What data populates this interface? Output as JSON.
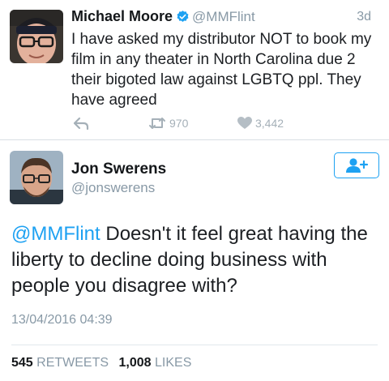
{
  "tweet1": {
    "name": "Michael Moore",
    "handle": "@MMFlint",
    "time": "3d",
    "text": "I have asked my distributor NOT to book my film in any theater in North Carolina due 2 their bigoted law against LGBTQ ppl. They have agreed",
    "retweets": "970",
    "likes": "3,442",
    "icons": {
      "reply": "reply-icon",
      "retweet": "retweet-icon",
      "like": "heart-icon",
      "verified": "verified-badge-icon"
    }
  },
  "tweet2": {
    "name": "Jon Swerens",
    "handle": "@jonswerens",
    "mention": "@MMFlint",
    "text": " Doesn't it feel great having the liberty to decline doing business with people you disagree with?",
    "date": "13/04/2016 04:39",
    "retweet_count": "545",
    "retweet_label": "RETWEETS",
    "like_count": "1,008",
    "like_label": "LIKES",
    "icons": {
      "follow": "add-user-icon"
    }
  },
  "colors": {
    "accent": "#1da1f2",
    "muted": "#8899a6",
    "text": "#1c1f23"
  }
}
